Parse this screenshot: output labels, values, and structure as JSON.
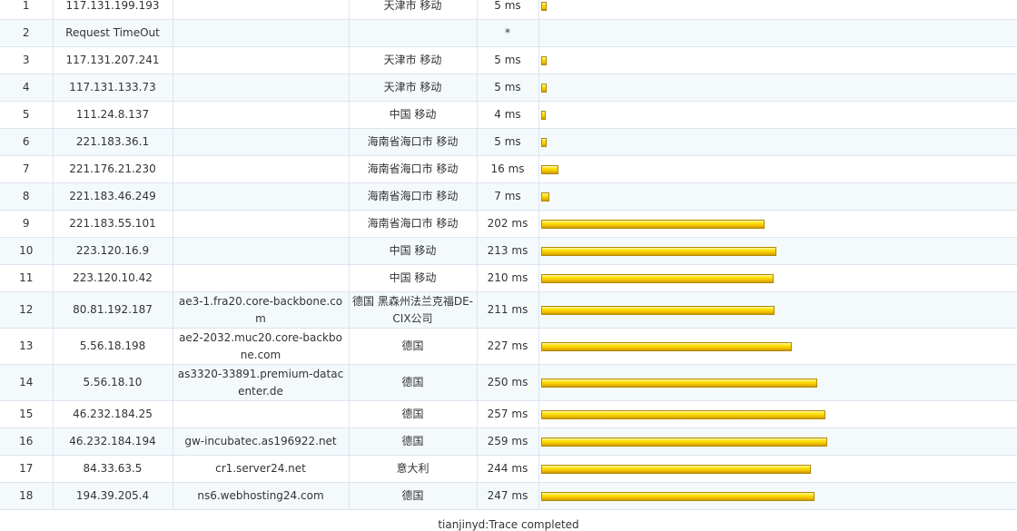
{
  "hops": [
    {
      "hop": "1",
      "ip": "117.131.199.193",
      "host": "",
      "location": "天津市 移动",
      "time": "5 ms",
      "ms": 5
    },
    {
      "hop": "2",
      "ip": "Request TimeOut",
      "host": "",
      "location": "",
      "time": "*",
      "ms": 0
    },
    {
      "hop": "3",
      "ip": "117.131.207.241",
      "host": "",
      "location": "天津市 移动",
      "time": "5 ms",
      "ms": 5
    },
    {
      "hop": "4",
      "ip": "117.131.133.73",
      "host": "",
      "location": "天津市 移动",
      "time": "5 ms",
      "ms": 5
    },
    {
      "hop": "5",
      "ip": "111.24.8.137",
      "host": "",
      "location": "中国 移动",
      "time": "4 ms",
      "ms": 4
    },
    {
      "hop": "6",
      "ip": "221.183.36.1",
      "host": "",
      "location": "海南省海口市 移动",
      "time": "5 ms",
      "ms": 5
    },
    {
      "hop": "7",
      "ip": "221.176.21.230",
      "host": "",
      "location": "海南省海口市 移动",
      "time": "16 ms",
      "ms": 16
    },
    {
      "hop": "8",
      "ip": "221.183.46.249",
      "host": "",
      "location": "海南省海口市 移动",
      "time": "7 ms",
      "ms": 7
    },
    {
      "hop": "9",
      "ip": "221.183.55.101",
      "host": "",
      "location": "海南省海口市 移动",
      "time": "202 ms",
      "ms": 202
    },
    {
      "hop": "10",
      "ip": "223.120.16.9",
      "host": "",
      "location": "中国 移动",
      "time": "213 ms",
      "ms": 213
    },
    {
      "hop": "11",
      "ip": "223.120.10.42",
      "host": "",
      "location": "中国 移动",
      "time": "210 ms",
      "ms": 210
    },
    {
      "hop": "12",
      "ip": "80.81.192.187",
      "host": "ae3-1.fra20.core-backbone.com",
      "location": "德国 黑森州法兰克福DE-CIX公司",
      "time": "211 ms",
      "ms": 211
    },
    {
      "hop": "13",
      "ip": "5.56.18.198",
      "host": "ae2-2032.muc20.core-backbone.com",
      "location": "德国",
      "time": "227 ms",
      "ms": 227
    },
    {
      "hop": "14",
      "ip": "5.56.18.10",
      "host": "as3320-33891.premium-datacenter.de",
      "location": "德国",
      "time": "250 ms",
      "ms": 250
    },
    {
      "hop": "15",
      "ip": "46.232.184.25",
      "host": "",
      "location": "德国",
      "time": "257 ms",
      "ms": 257
    },
    {
      "hop": "16",
      "ip": "46.232.184.194",
      "host": "gw-incubatec.as196922.net",
      "location": "德国",
      "time": "259 ms",
      "ms": 259
    },
    {
      "hop": "17",
      "ip": "84.33.63.5",
      "host": "cr1.server24.net",
      "location": "意大利",
      "time": "244 ms",
      "ms": 244
    },
    {
      "hop": "18",
      "ip": "194.39.205.4",
      "host": "ns6.webhosting24.com",
      "location": "德国",
      "time": "247 ms",
      "ms": 247
    }
  ],
  "footer": "tianjinyd:Trace completed",
  "colors": {
    "bar": "#ffd700",
    "grid": "#dde4f0",
    "row_alt": "#f4fafc"
  }
}
